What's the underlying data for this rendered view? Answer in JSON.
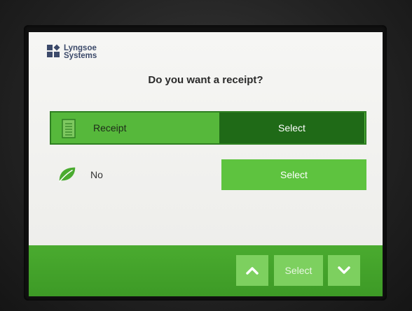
{
  "logo": {
    "line1": "Lyngsoe",
    "line2": "Systems"
  },
  "screen": {
    "title": "Do you want a receipt?"
  },
  "options": [
    {
      "label": "Receipt",
      "button_label": "Select",
      "icon": "receipt-paper-icon",
      "highlighted": true
    },
    {
      "label": "No",
      "button_label": "Select",
      "icon": "leaf-icon",
      "highlighted": false
    }
  ],
  "footer": {
    "up_icon": "chevron-up-icon",
    "select_label": "Select",
    "down_icon": "chevron-down-icon"
  },
  "colors": {
    "highlight_row": "#56b83b",
    "selected_button": "#1f6a17",
    "button": "#5ec33f",
    "footer": "#4aab2f",
    "brand": "#3c4a6a"
  }
}
